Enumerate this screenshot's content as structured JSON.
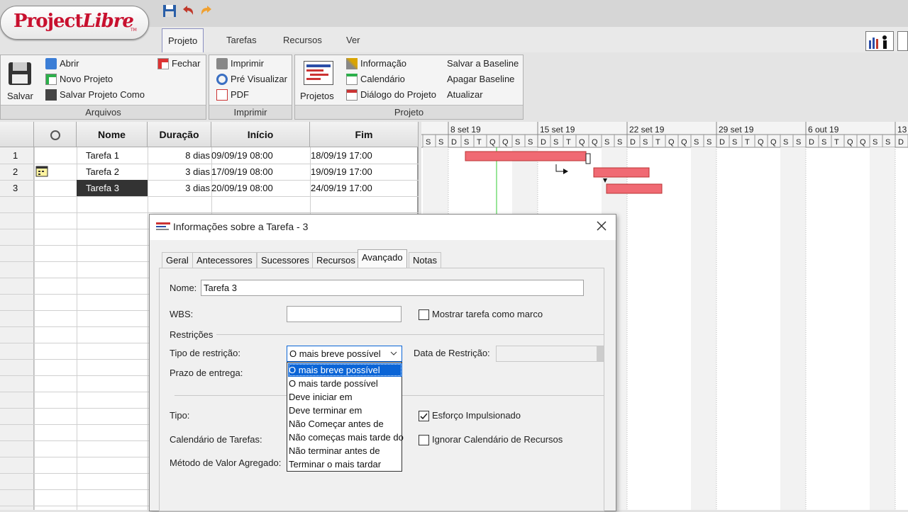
{
  "app": {
    "logo_text_a": "Project",
    "logo_text_b": "Libre",
    "logo_tm": "TM"
  },
  "menu_tabs": [
    "Projeto",
    "Tarefas",
    "Recursos",
    "Ver"
  ],
  "ribbon": {
    "arquivos": {
      "title": "Arquivos",
      "salvar": "Salvar",
      "abrir": "Abrir",
      "novo": "Novo Projeto",
      "salvar_como": "Salvar Projeto Como",
      "fechar": "Fechar"
    },
    "imprimir": {
      "title": "Imprimir",
      "imprimir": "Imprimir",
      "pre": "Pré Visualizar",
      "pdf": "PDF"
    },
    "projeto": {
      "title": "Projeto",
      "projetos": "Projetos",
      "informacao": "Informação",
      "calendario": "Calendário",
      "dialogo": "Diálogo do Projeto",
      "salvar_baseline": "Salvar a Baseline",
      "apagar_baseline": "Apagar Baseline",
      "atualizar": "Atualizar"
    }
  },
  "grid": {
    "headers": {
      "nome": "Nome",
      "duracao": "Duração",
      "inicio": "Início",
      "fim": "Fim"
    },
    "rows": [
      {
        "id": "1",
        "nome": "Tarefa 1",
        "duracao": "8 dias",
        "inicio": "09/09/19 08:00",
        "fim": "18/09/19 17:00"
      },
      {
        "id": "2",
        "nome": "Tarefa 2",
        "duracao": "3 dias",
        "inicio": "17/09/19 08:00",
        "fim": "19/09/19 17:00"
      },
      {
        "id": "3",
        "nome": "Tarefa 3",
        "duracao": "3 dias",
        "inicio": "20/09/19 08:00",
        "fim": "24/09/19 17:00"
      }
    ]
  },
  "gantt": {
    "weeks": [
      "8 set 19",
      "15 set 19",
      "22 set 19",
      "29 set 19",
      "6 out 19",
      "13"
    ],
    "day_letters": [
      "S",
      "S",
      "D",
      "S",
      "T",
      "Q",
      "Q",
      "S",
      "S",
      "D",
      "S",
      "T",
      "Q",
      "Q",
      "S",
      "S",
      "D",
      "S",
      "T",
      "Q",
      "Q",
      "S",
      "S",
      "D",
      "S",
      "T",
      "Q",
      "Q",
      "S",
      "S",
      "D",
      "S",
      "T",
      "Q",
      "Q",
      "S",
      "S",
      "D",
      "S",
      "T",
      "Q",
      "Q",
      "S",
      "S",
      "D",
      "S",
      "T",
      "Q",
      "Q",
      "S",
      "S"
    ],
    "bar_color": "#f06a73"
  },
  "dialog": {
    "title": "Informações sobre a Tarefa - 3",
    "tabs": [
      "Geral",
      "Antecessores",
      "Sucessores",
      "Recursos",
      "Avançado",
      "Notas"
    ],
    "active_tab": "Avançado",
    "nome_label": "Nome:",
    "nome_value": "Tarefa 3",
    "wbs_label": "WBS:",
    "wbs_value": "",
    "marco_label": "Mostrar tarefa como marco",
    "restricoes_label": "Restrições",
    "tipo_restricao_label": "Tipo de restrição:",
    "tipo_restricao_value": "O mais breve possível",
    "data_restricao_label": "Data de Restrição:",
    "prazo_label": "Prazo de entrega:",
    "tipo_label": "Tipo:",
    "calendario_label": "Calendário de Tarefas:",
    "metodo_label": "Método de Valor Agregado:",
    "esforco_label": "Esforço Impulsionado",
    "esforco_checked": true,
    "ignorar_label": "Ignorar Calendário de Recursos",
    "ignorar_checked": false,
    "dropdown_options": [
      "O mais breve possível",
      "O mais tarde possível",
      "Deve iniciar em",
      "Deve terminar em",
      "Não Começar antes de",
      "Não começas mais tarde do",
      "Não terminar antes de",
      "Terminar o mais tardar"
    ],
    "dropdown_selected": 0
  }
}
